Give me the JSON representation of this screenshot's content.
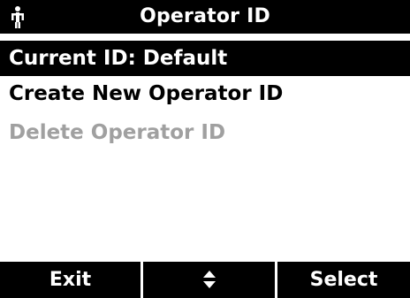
{
  "header": {
    "title": "Operator ID",
    "icon": "operator-person-icon"
  },
  "menu": {
    "items": [
      {
        "label": "Current ID: Default",
        "state": "selected"
      },
      {
        "label": "Create New Operator ID",
        "state": "normal"
      },
      {
        "label": "Delete Operator ID",
        "state": "disabled"
      }
    ]
  },
  "softkeys": {
    "left": "Exit",
    "middle_icon": "up-down-arrows-icon",
    "right": "Select"
  },
  "colors": {
    "bar": "#000000",
    "text_on_bar": "#ffffff",
    "disabled_text": "#a0a0a0"
  }
}
